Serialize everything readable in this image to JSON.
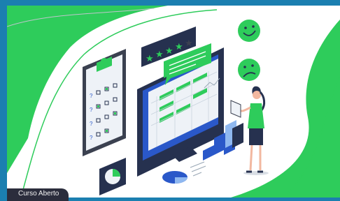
{
  "badge": {
    "label": "Curso Aberto"
  },
  "rating": {
    "filled_stars": 4,
    "total_stars": 5
  },
  "colors": {
    "frame": "#1b7fb0",
    "accent_green": "#2ecc5b",
    "dark_navy": "#26314f",
    "blue": "#2a58c9",
    "light_blue": "#8fb8f0",
    "badge_bg": "#2b2d3c"
  },
  "icons": [
    "clipboard-icon",
    "smiley-happy-icon",
    "smiley-sad-icon",
    "star-icon",
    "pie-chart-icon",
    "speech-bubble-icon"
  ]
}
